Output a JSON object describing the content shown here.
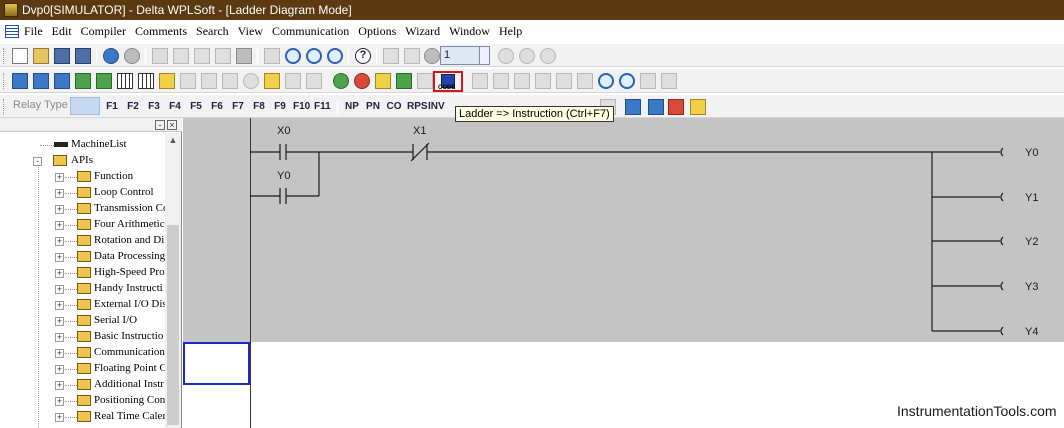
{
  "window": {
    "title": "Dvp0[SIMULATOR] - Delta WPLSoft - [Ladder Diagram Mode]"
  },
  "menu": [
    "File",
    "Edit",
    "Compiler",
    "Comments",
    "Search",
    "View",
    "Communication",
    "Options",
    "Wizard",
    "Window",
    "Help"
  ],
  "toolbar": {
    "station_value": "1",
    "code_label": "CODE",
    "relay_type_label": "Relay Type",
    "contact_buttons": [
      "F1",
      "F2",
      "F3",
      "F4",
      "F5",
      "F6",
      "F7",
      "F8",
      "F9",
      "F10",
      "F11",
      "NP",
      "PN",
      "CO",
      "RPS",
      "INV"
    ],
    "tooltip": "Ladder => Instruction (Ctrl+F7)"
  },
  "tree": {
    "items": [
      {
        "label": "MachineList"
      },
      {
        "label": "APIs"
      },
      {
        "label": "Function"
      },
      {
        "label": "Loop Control"
      },
      {
        "label": "Transmission Co"
      },
      {
        "label": "Four Arithmetic"
      },
      {
        "label": "Rotation and Di"
      },
      {
        "label": "Data Processing"
      },
      {
        "label": "High-Speed Proc"
      },
      {
        "label": "Handy Instructi"
      },
      {
        "label": "External I/O Dis"
      },
      {
        "label": "Serial I/O"
      },
      {
        "label": "Basic Instructio"
      },
      {
        "label": "Communication"
      },
      {
        "label": "Floating Point C"
      },
      {
        "label": "Additional Instr"
      },
      {
        "label": "Positioning Con"
      },
      {
        "label": "Real Time Caler"
      }
    ]
  },
  "ladder": {
    "contacts": [
      {
        "label": "X0",
        "type": "NO"
      },
      {
        "label": "X1",
        "type": "NC"
      },
      {
        "label": "Y0",
        "type": "NO"
      }
    ],
    "coils": [
      "Y0",
      "Y1",
      "Y2",
      "Y3",
      "Y4"
    ]
  },
  "watermark": "InstrumentationTools.com",
  "colors": {
    "titlebar": "#5b3a12",
    "ladder_background": "#c4c4c4",
    "highlight_border": "#d8141a",
    "cursor_border": "#1a2cc8"
  }
}
